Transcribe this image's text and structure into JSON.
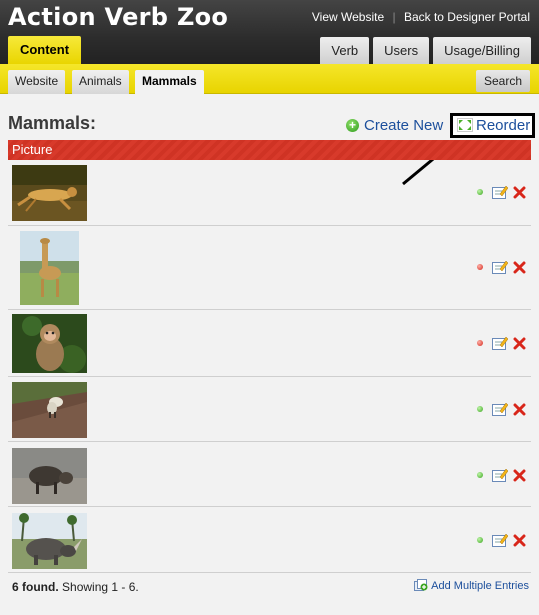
{
  "app": {
    "title": "Action Verb Zoo"
  },
  "toplinks": {
    "view_website": "View Website",
    "separator": "|",
    "back": "Back to Designer Portal"
  },
  "main_tabs": {
    "content": "Content",
    "verb": "Verb",
    "users": "Users",
    "usage": "Usage/Billing"
  },
  "sub_tabs": {
    "website": "Website",
    "animals": "Animals",
    "mammals": "Mammals",
    "search": "Search"
  },
  "section": {
    "title": "Mammals:",
    "create_new": "Create New",
    "reorder": "Reorder"
  },
  "table": {
    "column_header": "Picture",
    "rows": [
      {
        "animal": "cheetah",
        "status": "green"
      },
      {
        "animal": "giraffe",
        "status": "red"
      },
      {
        "animal": "monkey",
        "status": "red"
      },
      {
        "animal": "hyena",
        "status": "green"
      },
      {
        "animal": "warthog",
        "status": "green"
      },
      {
        "animal": "rhino",
        "status": "green"
      }
    ]
  },
  "footer": {
    "found": "6 found.",
    "showing": "Showing 1 - 6.",
    "add_multiple": "Add Multiple Entries"
  },
  "colors": {
    "accent_yellow": "#f0e01a",
    "header_red": "#d83a2b",
    "link_blue": "#1c4f9c",
    "status_green": "#3aa51e",
    "status_red": "#d3261a"
  }
}
